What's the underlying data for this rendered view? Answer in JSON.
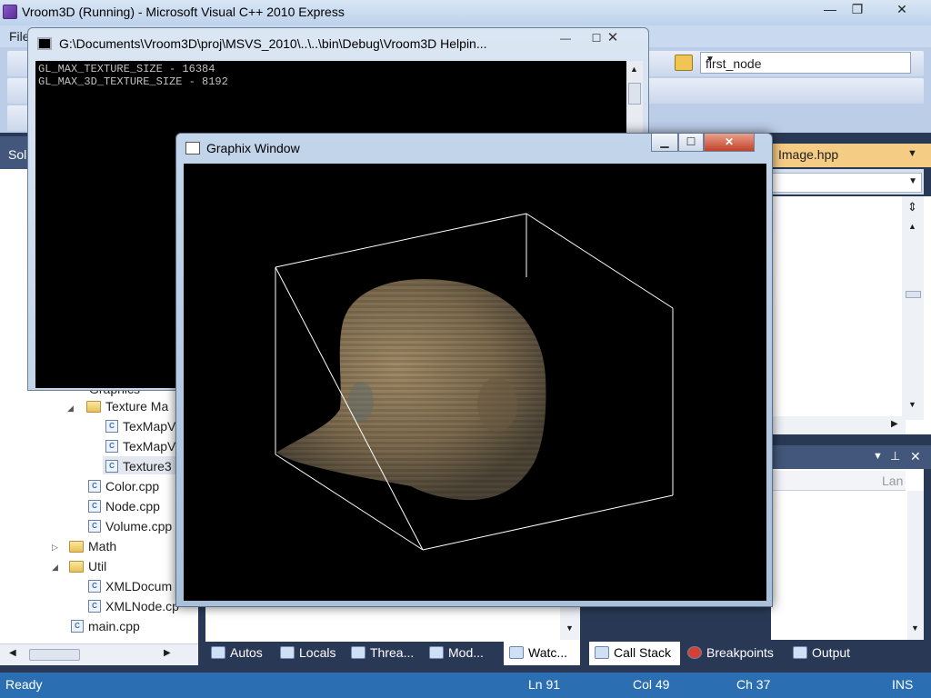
{
  "vs": {
    "title": "Vroom3D (Running) - Microsoft Visual C++ 2010 Express",
    "menu": {
      "file": "File"
    },
    "toolbar": {
      "node_combo": "first_node"
    },
    "window_buttons": {
      "minimize": "—",
      "maximize": "❐",
      "close": "✕"
    }
  },
  "solution_explorer": {
    "header": "Sol",
    "items": [
      {
        "label": "Graphics"
      },
      {
        "label": "Texture Ma"
      },
      {
        "label": "TexMapV"
      },
      {
        "label": "TexMapV"
      },
      {
        "label": "Texture3"
      },
      {
        "label": "Color.cpp"
      },
      {
        "label": "Node.cpp"
      },
      {
        "label": "Volume.cpp"
      },
      {
        "label": "Math"
      },
      {
        "label": "Util"
      },
      {
        "label": "XMLDocum"
      },
      {
        "label": "XMLNode.cp"
      },
      {
        "label": "main.cpp"
      }
    ]
  },
  "editor": {
    "tab": "Image.hpp"
  },
  "call_stack": {
    "col_lang": "Lan"
  },
  "console": {
    "title": "G:\\Documents\\Vroom3D\\proj\\MSVS_2010\\..\\..\\bin\\Debug\\Vroom3D Helpin...",
    "lines": [
      "GL_MAX_TEXTURE_SIZE - 16384",
      "GL_MAX_3D_TEXTURE_SIZE - 8192"
    ]
  },
  "graphix": {
    "title": "Graphix Window"
  },
  "bottom_tabs": {
    "autos": "Autos",
    "locals": "Locals",
    "threads": "Threa...",
    "modules": "Mod...",
    "watch": "Watc...",
    "callstack": "Call Stack",
    "breakpoints": "Breakpoints",
    "output": "Output"
  },
  "status": {
    "ready": "Ready",
    "ln": "Ln 91",
    "col": "Col 49",
    "ch": "Ch 37",
    "ins": "INS"
  }
}
